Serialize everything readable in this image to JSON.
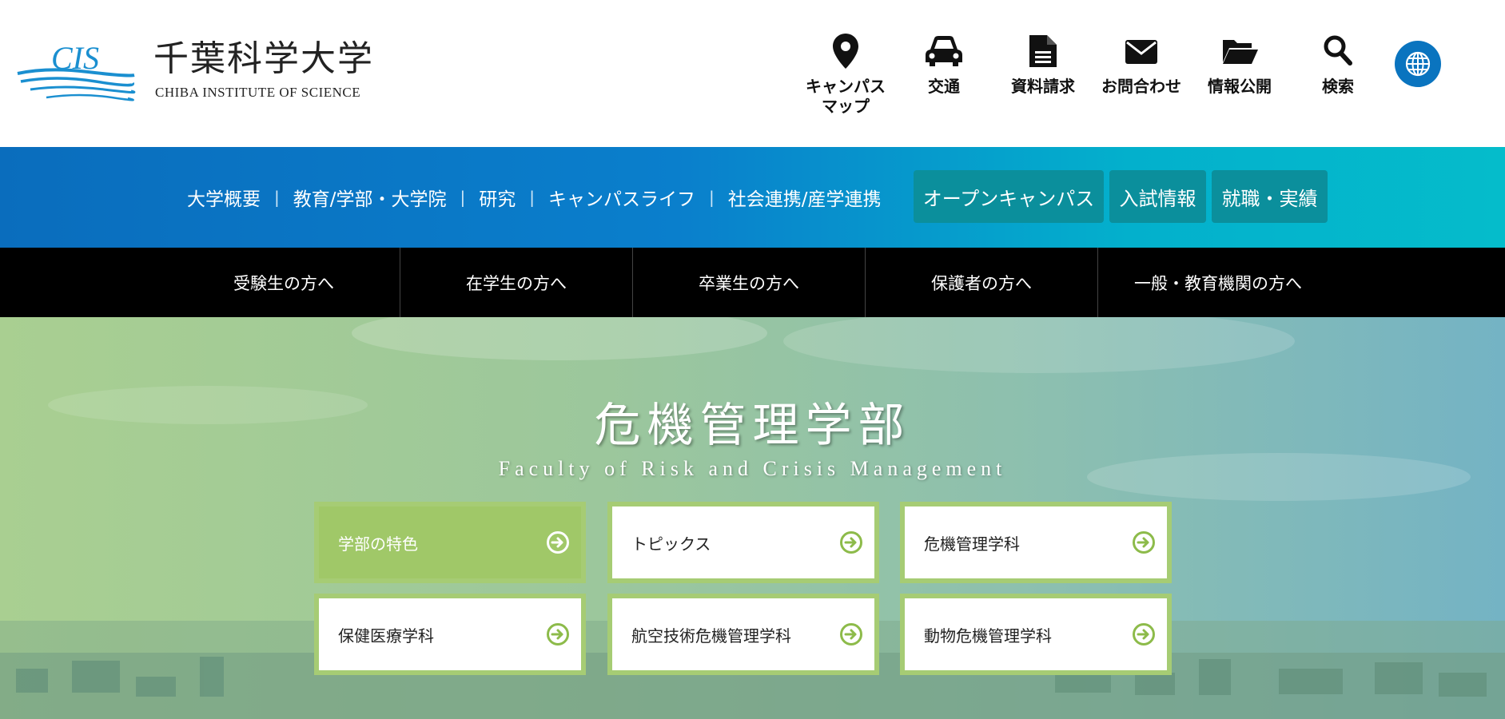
{
  "header": {
    "logo": {
      "mark": "CIS",
      "name_ja": "千葉科学大学",
      "name_en": "CHIBA INSTITUTE OF SCIENCE"
    },
    "utility_links": [
      {
        "icon": "map-pin-icon",
        "label": "キャンパス\nマップ"
      },
      {
        "icon": "car-icon",
        "label": "交通"
      },
      {
        "icon": "document-icon",
        "label": "資料請求"
      },
      {
        "icon": "envelope-icon",
        "label": "お問合わせ"
      },
      {
        "icon": "folder-open-icon",
        "label": "情報公開"
      },
      {
        "icon": "search-icon",
        "label": "検索"
      }
    ],
    "language_icon": "globe-icon"
  },
  "global_nav": {
    "links": [
      "大学概要",
      "教育/学部・大学院",
      "研究",
      "キャンパスライフ",
      "社会連携/産学連携"
    ],
    "separator": "|",
    "buttons": [
      "オープンキャンパス",
      "入試情報",
      "就職・実績"
    ]
  },
  "audience_nav": [
    "受験生の方へ",
    "在学生の方へ",
    "卒業生の方へ",
    "保護者の方へ",
    "一般・教育機関の方へ"
  ],
  "hero": {
    "title": "危機管理学部",
    "subtitle": "Faculty of Risk and Crisis Management",
    "cards": [
      {
        "label": "学部の特色",
        "active": true
      },
      {
        "label": "トピックス",
        "active": false
      },
      {
        "label": "危機管理学科",
        "active": false
      },
      {
        "label": "保健医療学科",
        "active": false
      },
      {
        "label": "航空技術危機管理学科",
        "active": false
      },
      {
        "label": "動物危機管理学科",
        "active": false
      }
    ]
  },
  "colors": {
    "brand_blue": "#0a74bf",
    "teal_button": "#0b8f9c",
    "card_green": "#a6cc74",
    "arrow_green": "#8dbb4a"
  }
}
